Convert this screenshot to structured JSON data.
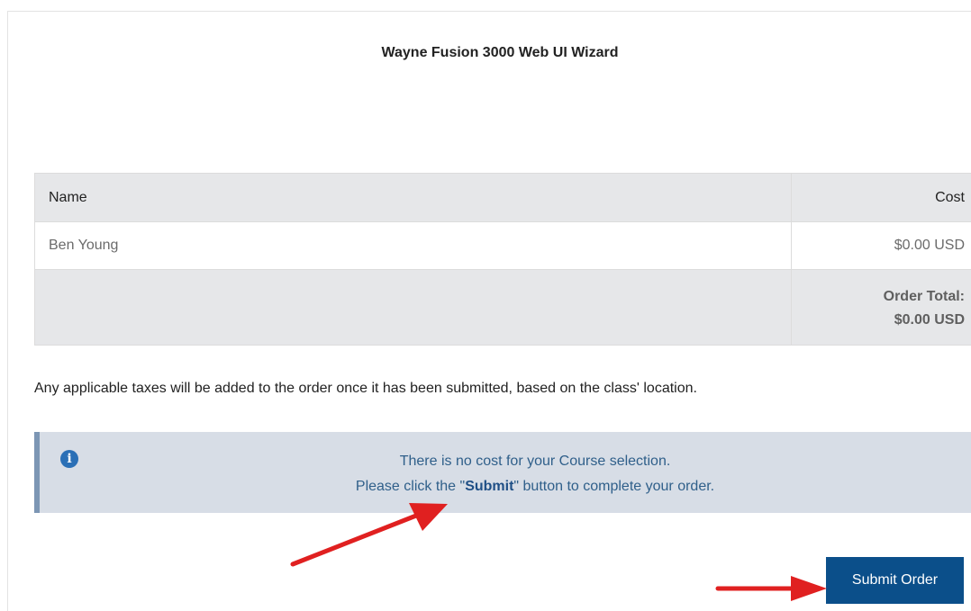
{
  "page": {
    "title": "Wayne Fusion 3000 Web UI Wizard"
  },
  "order_table": {
    "headers": {
      "name": "Name",
      "cost": "Cost"
    },
    "items": [
      {
        "name": "Ben Young",
        "cost": "$0.00 USD"
      }
    ],
    "total_label": "Order Total:",
    "total_value": "$0.00 USD"
  },
  "tax_note": "Any applicable taxes will be added to the order once it has been submitted, based on the class' location.",
  "info_box": {
    "icon": "info-icon",
    "line1": "There is no cost for your Course selection.",
    "line2_prefix": "Please click the \"",
    "line2_emphasis": "Submit",
    "line2_suffix": "\" button to complete your order."
  },
  "actions": {
    "submit_label": "Submit Order"
  },
  "colors": {
    "accent": "#0b4f8a",
    "info_background": "#d7dde6",
    "info_text": "#2f5f8a",
    "annotation_arrow": "#e02020"
  }
}
